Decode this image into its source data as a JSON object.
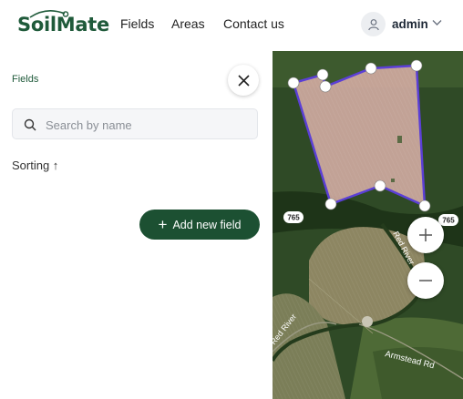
{
  "brand": {
    "name": "SoilMate"
  },
  "nav": {
    "fields": "Fields",
    "areas": "Areas",
    "contact": "Contact us"
  },
  "user": {
    "name": "admin"
  },
  "panel": {
    "title": "Fields",
    "search_placeholder": "Search by name",
    "sorting_label": "Sorting ↑",
    "add_button": "Add new field"
  },
  "map": {
    "road_badge_1": "765",
    "road_badge_2": "765",
    "road_label_1": "Red River",
    "road_label_2": "Red River",
    "road_label_3": "Armstead Rd"
  },
  "colors": {
    "brand_green": "#1f5a3a",
    "button_green": "#1c5032",
    "polygon": "#5b3fd6"
  },
  "icons": {
    "close": "close-icon",
    "search": "search-icon",
    "zoom_in": "plus-icon",
    "zoom_out": "minus-icon",
    "avatar": "user-icon",
    "chevron": "chevron-down-icon"
  }
}
